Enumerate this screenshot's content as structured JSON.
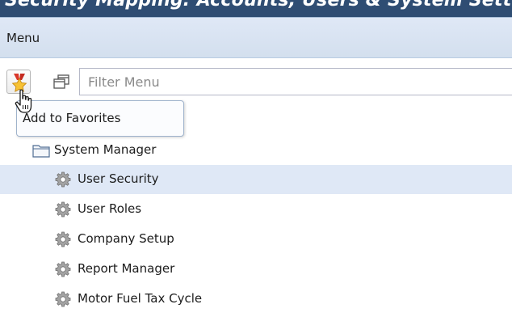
{
  "window": {
    "title": "Security Mapping: Accounts, Users & System Settings"
  },
  "menu_panel": {
    "title": "Menu"
  },
  "toolbar": {
    "favorites_icon": "star-medal-icon",
    "expand_collapse_icon": "copy-windows-icon",
    "filter_placeholder": "Filter Menu",
    "filter_value": ""
  },
  "tooltip": {
    "text": "Add to Favorites"
  },
  "tree": {
    "folder": {
      "label": "System Manager",
      "icon": "folder-icon"
    },
    "items": [
      {
        "label": "User Security",
        "icon": "gear-icon",
        "selected": true
      },
      {
        "label": "User Roles",
        "icon": "gear-icon",
        "selected": false
      },
      {
        "label": "Company Setup",
        "icon": "gear-icon",
        "selected": false
      },
      {
        "label": "Report Manager",
        "icon": "gear-icon",
        "selected": false
      },
      {
        "label": "Motor Fuel Tax Cycle",
        "icon": "gear-icon",
        "selected": false
      }
    ]
  },
  "colors": {
    "header_bg": "#2f4d73",
    "menu_bar_bg": "#dfe8f6",
    "selected_row_bg": "#dfe8f6"
  }
}
